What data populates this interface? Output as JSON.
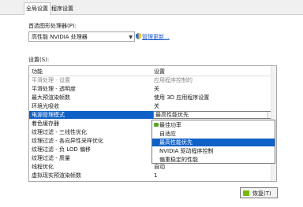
{
  "tabs": [
    {
      "label": "全局设置"
    },
    {
      "label": "程序设置"
    }
  ],
  "gpu_section": {
    "label": "首选图形处理器(P):",
    "selected": "高性能 NVIDIA 处理器",
    "manage_link": "管理更新..."
  },
  "settings": {
    "label": "设置(S):",
    "header": {
      "feature": "功能",
      "setting": "设置"
    },
    "rows": [
      {
        "feature": "平滑处理 - 设置",
        "setting": "应用程序控制的"
      },
      {
        "feature": "平滑处理 - 透明度",
        "setting": "关"
      },
      {
        "feature": "最大预渲染帧数",
        "setting": "使用 3D 应用程序设置"
      },
      {
        "feature": "环境光吸收",
        "setting": "关"
      },
      {
        "feature": "电源管理模式",
        "setting": "最高性能优先"
      },
      {
        "feature": "着色缓存器",
        "setting": ""
      },
      {
        "feature": "纹理过滤 - 三线性优化",
        "setting": ""
      },
      {
        "feature": "纹理过滤 - 各向异性采样优化",
        "setting": ""
      },
      {
        "feature": "纹理过滤 - 负 LOD 偏移",
        "setting": ""
      },
      {
        "feature": "纹理过滤 - 质量",
        "setting": ""
      },
      {
        "feature": "线程优化",
        "setting": "自动"
      },
      {
        "feature": "虚拟现实预渲染帧数",
        "setting": "1"
      }
    ],
    "dropdown_options": [
      {
        "label": "最佳功率"
      },
      {
        "label": "自适应"
      },
      {
        "label": "最高性能优先"
      },
      {
        "label": "NVIDIA 驱动程序控制"
      },
      {
        "label": "偏重稳定的性能"
      }
    ]
  },
  "restore_button": {
    "label": "恢复(T)"
  },
  "colors": {
    "selection": "#0f61c8",
    "nvidia_green": "#76b900",
    "link": "#1a55c8"
  }
}
